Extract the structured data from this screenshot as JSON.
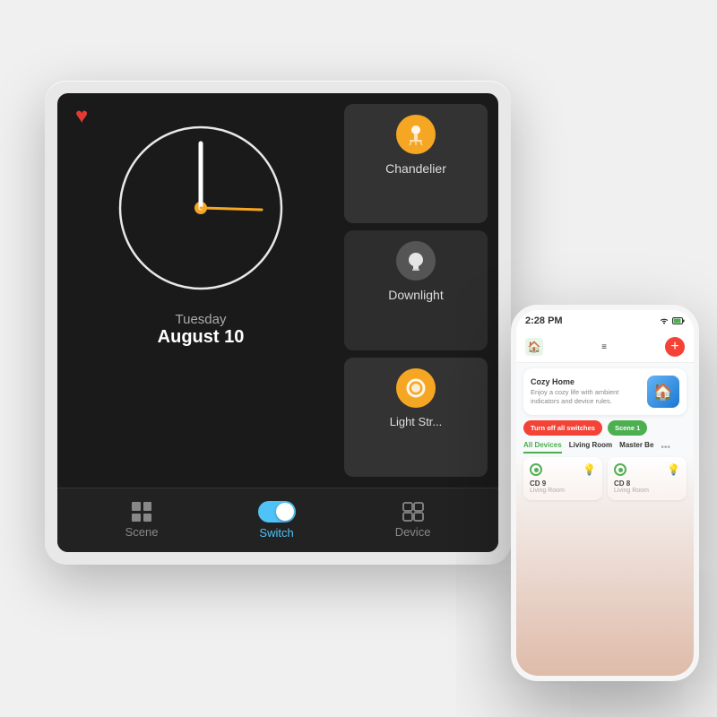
{
  "panel": {
    "heart_icon": "♥",
    "clock": {
      "day": "Tuesday",
      "date": "August 10"
    },
    "controls": [
      {
        "id": "chandelier",
        "label": "Chandelier",
        "active": true
      },
      {
        "id": "downlight",
        "label": "Downlight",
        "active": false
      },
      {
        "id": "light_strip",
        "label": "Light Str...",
        "active": true
      }
    ],
    "nav": {
      "scene": {
        "label": "Scene"
      },
      "switch": {
        "label": "Switch"
      },
      "device": {
        "label": "Device"
      }
    }
  },
  "phone": {
    "status_bar": {
      "time": "2:28 PM",
      "battery": "🔋"
    },
    "app": {
      "home_title": "Cozy Home",
      "cozy_description": "Enjoy a cozy life with ambient indicators and device rules.",
      "btn_turn_off": "Turn off all switches",
      "btn_scene": "Scene 1",
      "tabs": [
        "All Devices",
        "Living Room",
        "Master Be",
        "..."
      ],
      "devices": [
        {
          "name": "CD 9",
          "location": "Living Room"
        },
        {
          "name": "CD 8",
          "location": "Living Room"
        }
      ]
    }
  }
}
